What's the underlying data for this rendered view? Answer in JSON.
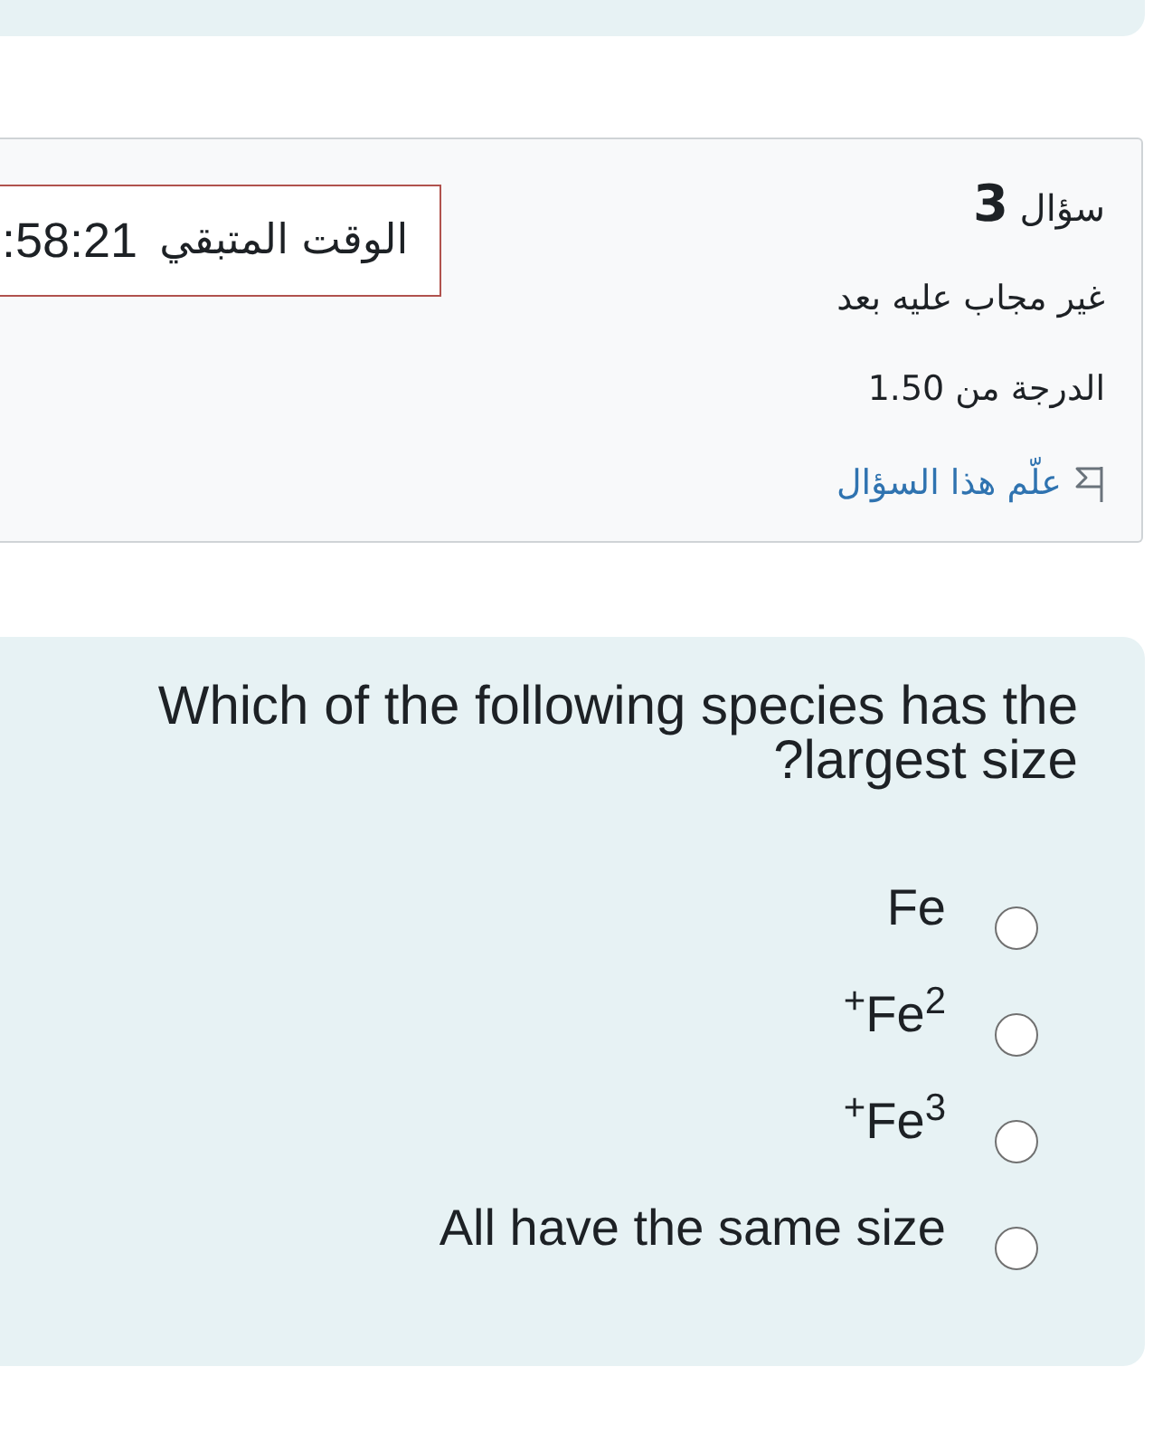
{
  "question_info": {
    "title": "سؤال **3**",
    "state": "غير مجاب عليه بعد",
    "grade": "الدرجة من 1.50",
    "flag_link": "علّم هذا السؤال"
  },
  "timer": {
    "label": "الوقت المتبقي",
    "value": ":58:21"
  },
  "question": {
    "text": "Which of the following species has the ?largest size",
    "options": [
      {
        "label": "Fe",
        "selected": false
      },
      {
        "label": "$^{+}$Fe$^{2}$",
        "selected": false
      },
      {
        "label": "$^{+}$Fe$^{3}$",
        "selected": false
      },
      {
        "label": "All have the same size",
        "selected": false
      }
    ]
  }
}
